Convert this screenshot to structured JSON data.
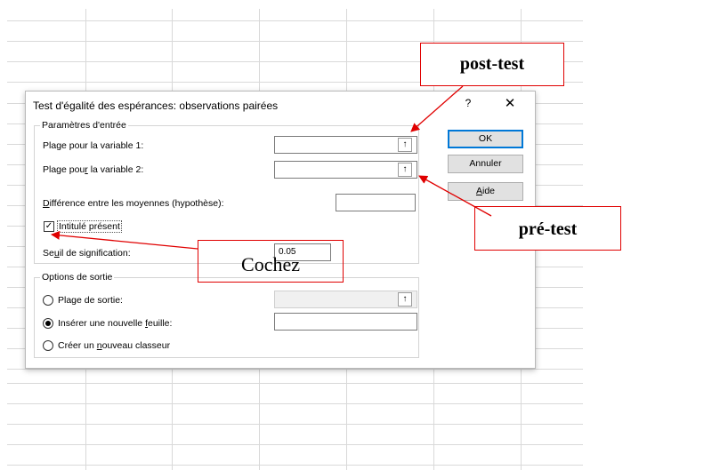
{
  "dialog": {
    "title": "Test d'égalité des espérances: observations pairées",
    "help_label": "?",
    "close_label": "✕",
    "input_group": {
      "legend": "Paramètres d'entrée",
      "var1_label": "Plage pour la variable 1:",
      "var2_label": "Plage pour la variable 2:",
      "diff_label": "Différence entre les moyennes (hypothèse):",
      "labels_checkbox": "Intitulé présent",
      "labels_checked": true,
      "alpha_label": "Seuil de signification:",
      "alpha_value": "0.05"
    },
    "output_group": {
      "legend": "Options de sortie",
      "range_label": "Plage de sortie:",
      "new_sheet_label": "Insérer une nouvelle feuille:",
      "new_workbook_label": "Créer un nouveau classeur",
      "selected": "new_sheet"
    },
    "buttons": {
      "ok": "OK",
      "cancel": "Annuler",
      "help": "Aide"
    }
  },
  "annotations": {
    "post_test": "post-test",
    "pre_test": "pré-test",
    "cochez": "Cochez",
    "color": "#e00000"
  },
  "icons": {
    "ref_button": "collapse-dialog-arrow-icon"
  }
}
